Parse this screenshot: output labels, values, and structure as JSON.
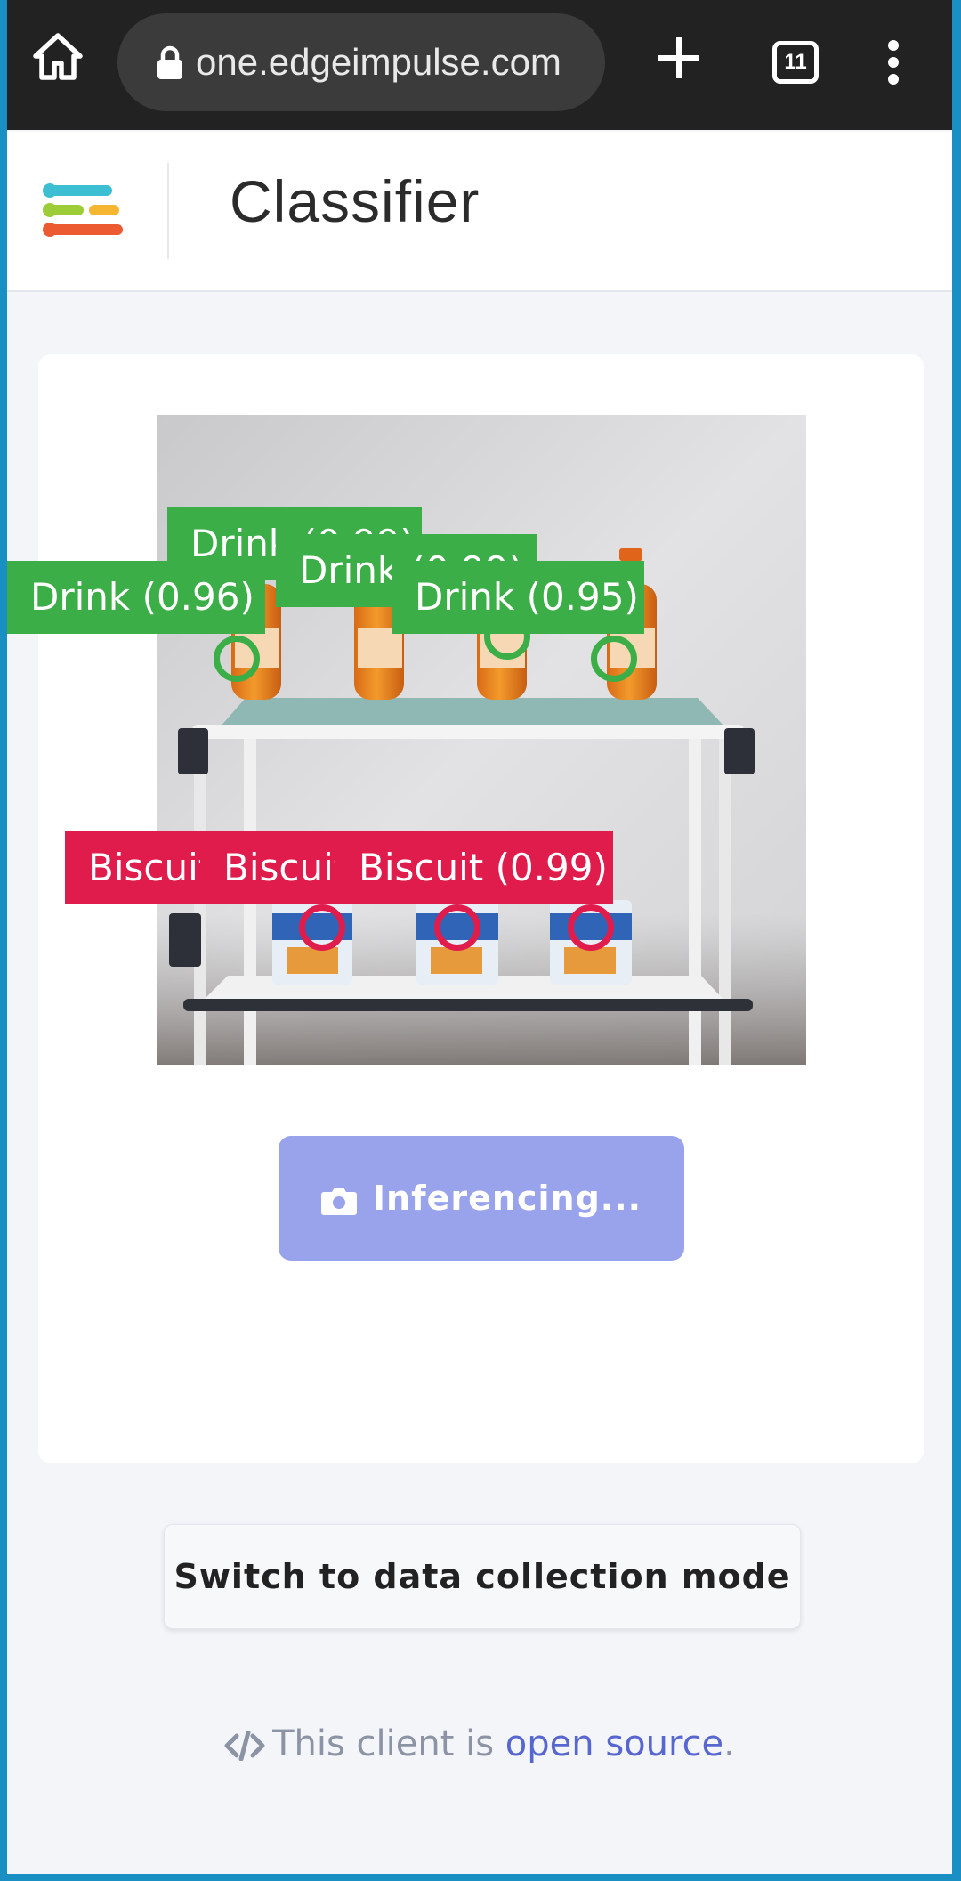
{
  "browser": {
    "url": "one.edgeimpulse.com",
    "tab_count": "11",
    "icons": [
      "home-icon",
      "lock-icon",
      "plus-icon",
      "tabs-icon",
      "more-vert-icon"
    ]
  },
  "header": {
    "title": "Classifier"
  },
  "detections": [
    {
      "label": "Drink (0.99)",
      "class": "drink"
    },
    {
      "label": "Drink (0.99)",
      "class": "drink"
    },
    {
      "label": "Drink (0.96)",
      "class": "drink"
    },
    {
      "label": "Drink (0.95)",
      "class": "drink"
    },
    {
      "label": "Biscuit (0.99)",
      "class": "biscuit"
    },
    {
      "label": "Biscuit (0.99)",
      "class": "biscuit"
    },
    {
      "label": "Biscuit (0.99)",
      "class": "biscuit"
    }
  ],
  "classes": {
    "drink_color": "#3cae47",
    "biscuit_color": "#e01c4c"
  },
  "card": {
    "button_label": "Inferencing...",
    "button_icon": "camera-icon",
    "button_color": "#98a3ec"
  },
  "switch_mode_label": "Switch to data collection mode",
  "footer": {
    "prefix": "This client is",
    "link_text": "open source",
    "suffix": ".",
    "icon": "code-icon",
    "link_color": "#5866d0"
  }
}
